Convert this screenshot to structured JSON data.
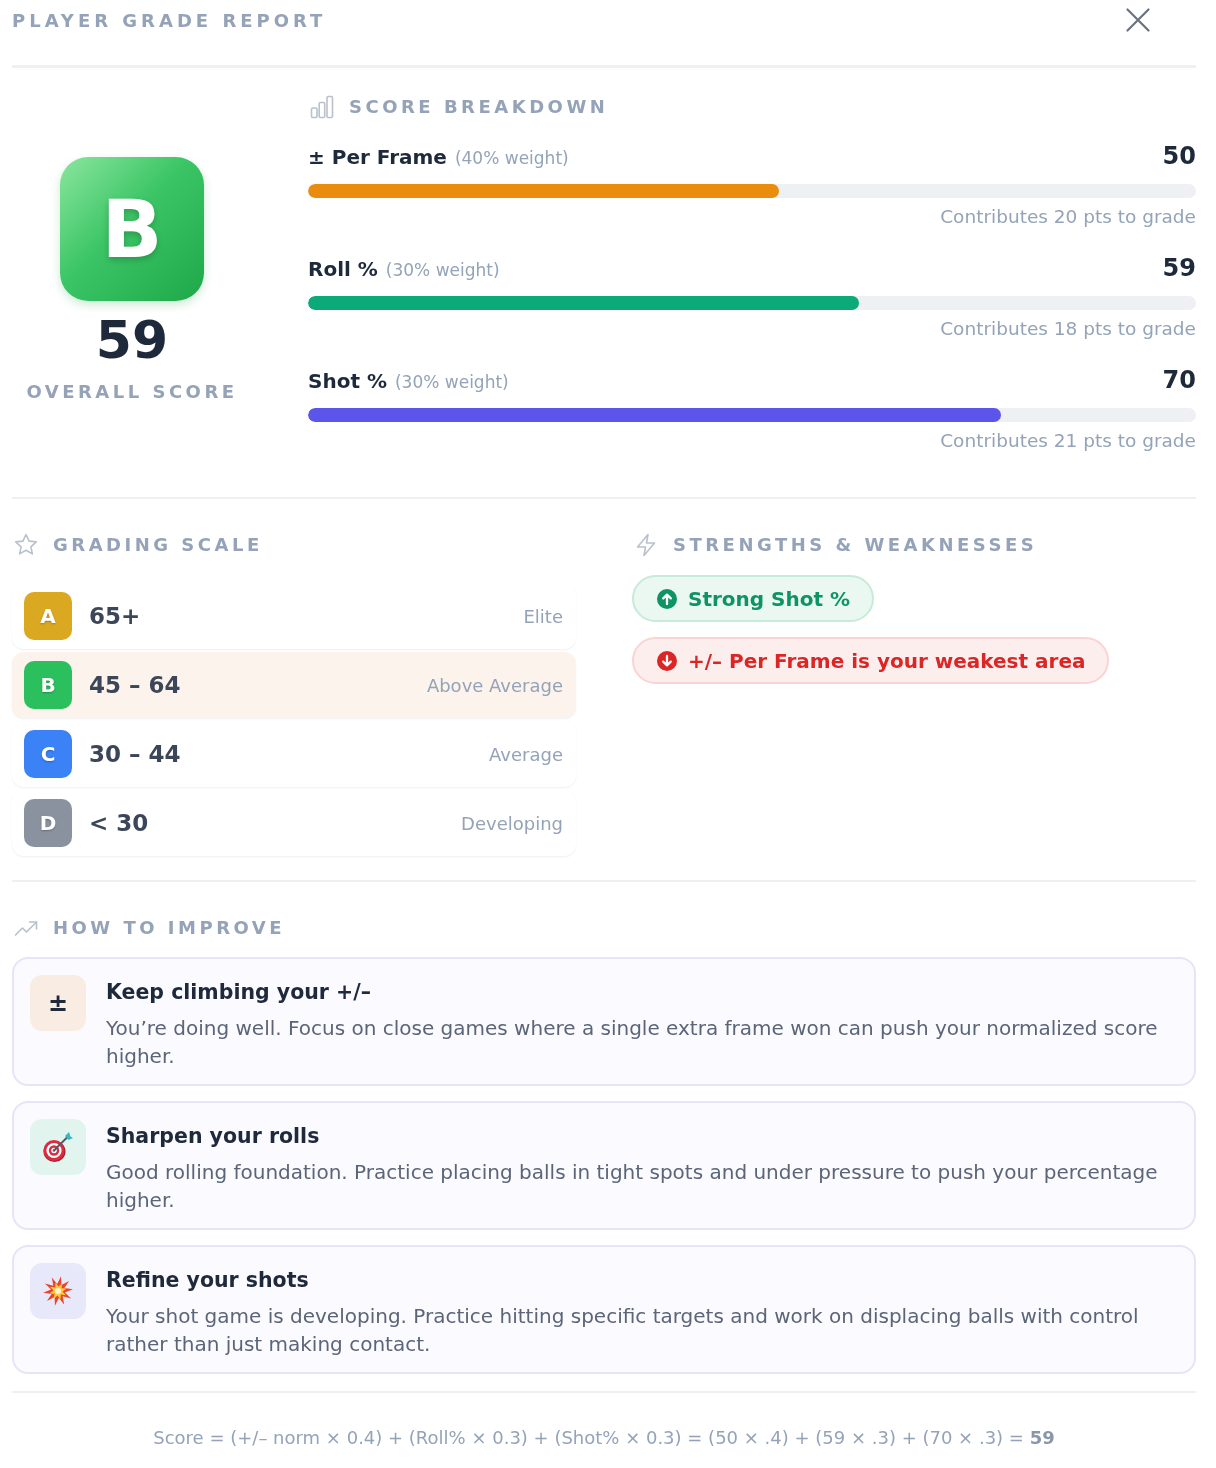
{
  "header": {
    "title": "PLAYER GRADE REPORT"
  },
  "overall": {
    "grade": "B",
    "score": "59",
    "label": "OVERALL SCORE"
  },
  "breakdown": {
    "title": "SCORE BREAKDOWN",
    "metrics": [
      {
        "name": "± Per Frame",
        "weight": "(40% weight)",
        "value": "50",
        "level": 0.53,
        "color": "#ea8c0e",
        "note": "Contributes 20 pts to grade"
      },
      {
        "name": "Roll %",
        "weight": "(30% weight)",
        "value": "59",
        "level": 0.62,
        "color": "#0caa78",
        "note": "Contributes 18 pts to grade"
      },
      {
        "name": "Shot %",
        "weight": "(30% weight)",
        "value": "70",
        "level": 0.78,
        "color": "#5b55e9",
        "note": "Contributes 21 pts to grade"
      }
    ]
  },
  "grading_scale": {
    "title": "GRADING SCALE",
    "rows": [
      {
        "grade": "A",
        "range": "65+",
        "label": "Elite",
        "color": "#dba822",
        "selected": false
      },
      {
        "grade": "B",
        "range": "45 – 64",
        "label": "Above Average",
        "color": "#2cbf5e",
        "selected": true
      },
      {
        "grade": "C",
        "range": "30 – 44",
        "label": "Average",
        "color": "#3b82f6",
        "selected": false
      },
      {
        "grade": "D",
        "range": "< 30",
        "label": "Developing",
        "color": "#8a919f",
        "selected": false
      }
    ]
  },
  "strengths_weaknesses": {
    "title": "STRENGTHS & WEAKNESSES",
    "items": [
      {
        "kind": "strength",
        "text": "Strong Shot %"
      },
      {
        "kind": "weakness",
        "text": "+/– Per Frame is your weakest area"
      }
    ]
  },
  "improve": {
    "title": "HOW TO IMPROVE",
    "tips": [
      {
        "kind": "glyph",
        "glyph": "±",
        "color": "#f9ede3",
        "title": "Keep climbing your +/–",
        "text": "You’re doing well. Focus on close games where a single extra frame won can push your normalized score higher."
      },
      {
        "kind": "target",
        "color": "#e2f4ee",
        "title": "Sharpen your rolls",
        "text": "Good rolling foundation. Practice placing balls in tight spots and under pressure to push your percentage higher."
      },
      {
        "kind": "burst",
        "color": "#e8e8fb",
        "title": "Refine your shots",
        "text": "Your shot game is developing. Practice hitting specific targets and work on displacing balls with control rather than just making contact."
      }
    ]
  },
  "footer": {
    "formula": "Score = (+/– norm × 0.4) + (Roll% × 0.3) + (Shot% × 0.3) = (50 × .4) + (59 × .3) + (70 × .3) = **59**"
  }
}
